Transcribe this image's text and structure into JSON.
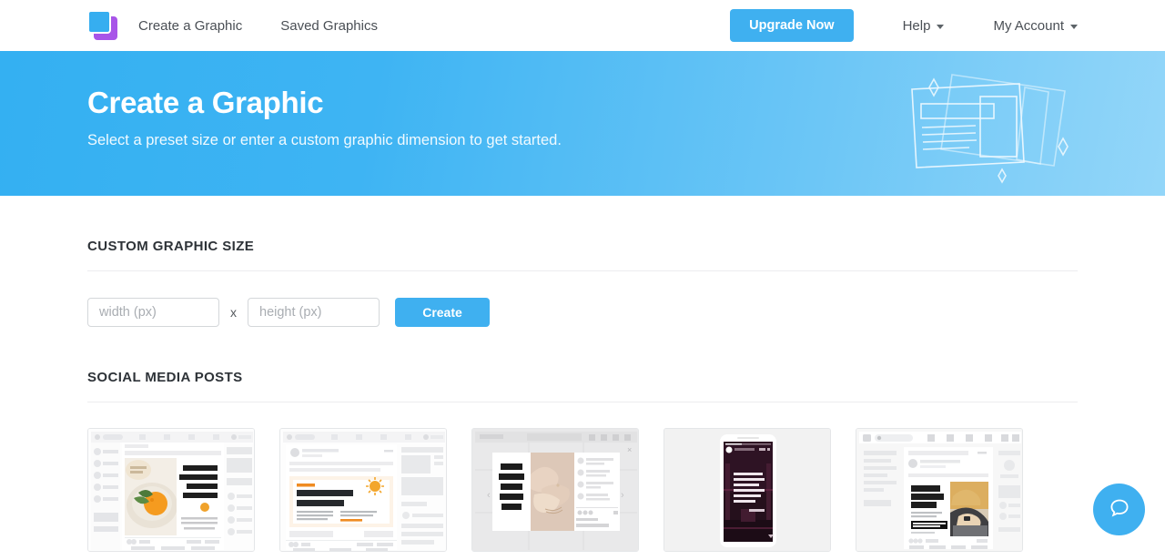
{
  "nav": {
    "logo_icon": "stacked-squares-logo",
    "links": [
      {
        "label": "Create a Graphic"
      },
      {
        "label": "Saved Graphics"
      }
    ],
    "upgrade_label": "Upgrade Now",
    "menus": [
      {
        "label": "Help"
      },
      {
        "label": "My Account"
      }
    ]
  },
  "hero": {
    "title": "Create a Graphic",
    "subtitle": "Select a preset size or enter a custom graphic dimension to get started.",
    "art_icon": "stacked-documents-illustration"
  },
  "custom_size": {
    "heading": "CUSTOM GRAPHIC SIZE",
    "width_placeholder": "width (px)",
    "width_value": "",
    "separator": "x",
    "height_placeholder": "height (px)",
    "height_value": "",
    "create_label": "Create"
  },
  "social_media": {
    "heading": "SOCIAL MEDIA POSTS",
    "thumbnails": [
      {
        "name": "facebook-post-juice",
        "headline": "GREAT JUICE FOR GREAT FRIENDS",
        "label": ""
      },
      {
        "name": "facebook-post-vitamin-d",
        "headline": "Top Ten Benefits of Vitamin D",
        "label": ""
      },
      {
        "name": "instagram-post-bogo",
        "headline": "BUY ONE, GET ONE 50% OFF",
        "label": ""
      },
      {
        "name": "instagram-story-quote",
        "headline": "\"Marketing is no longer about the stuff that you make but about the stories you tell.\"",
        "label": ""
      },
      {
        "name": "linkedin-post-editors",
        "headline": "Calling all online editors",
        "label": ""
      }
    ]
  },
  "chat": {
    "icon": "speech-bubble-icon"
  },
  "colors": {
    "accent_blue": "#3fb0f0",
    "hero_blue_start": "#34b0f2",
    "hero_blue_end": "#93d6f9",
    "logo_purple": "#a855e8",
    "text_dark": "#2e3338"
  }
}
